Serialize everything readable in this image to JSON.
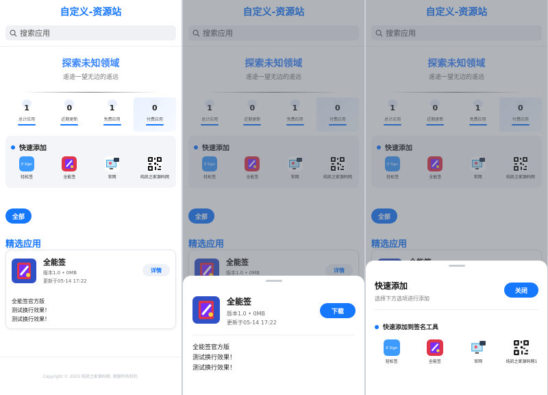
{
  "app": {
    "title": "自定义-资源站"
  },
  "search": {
    "placeholder": "搜索应用"
  },
  "hero": {
    "title": "探索未知领域",
    "subtitle": "遥途一望无边的遥远"
  },
  "stats": [
    {
      "value": "1",
      "label": "总计应用"
    },
    {
      "value": "0",
      "label": "近期更新"
    },
    {
      "value": "1",
      "label": "免费应用"
    },
    {
      "value": "0",
      "label": "付费应用"
    }
  ],
  "quick_add": {
    "title": "快速添加",
    "items": [
      {
        "label": "轻松签",
        "icon": "qingsongqian-icon",
        "logo_text": "E Sign"
      },
      {
        "label": "全能签",
        "icon": "quannengqian-icon"
      },
      {
        "label": "官网",
        "icon": "website-icon"
      },
      {
        "label": "纯凯之家源码网",
        "icon": "qrcode-icon"
      }
    ]
  },
  "filter": {
    "all_label": "全部"
  },
  "section": {
    "title": "精选应用"
  },
  "featured_app": {
    "name": "全能签",
    "version": "版本1.0 • 0MB",
    "updated": "更新于05-14 17:22",
    "detail_label": "详情",
    "download_label": "下载",
    "description": [
      "全能签官方版",
      "测试换行效果！",
      "测试换行效果！"
    ]
  },
  "footer": {
    "copyright": "Copyright © 2025 纯凯之家源码网. 保留所有权利."
  },
  "quick_add_sheet": {
    "title": "快速添加",
    "subtitle": "选择下方选项进行添加",
    "close_label": "关闭",
    "section_title": "快速添加到签名工具",
    "item_labels": [
      "轻松签",
      "全能签",
      "官网",
      "纯凯之家源码网1"
    ]
  },
  "colors": {
    "accent": "#1677ff",
    "overlay": "#505662"
  }
}
